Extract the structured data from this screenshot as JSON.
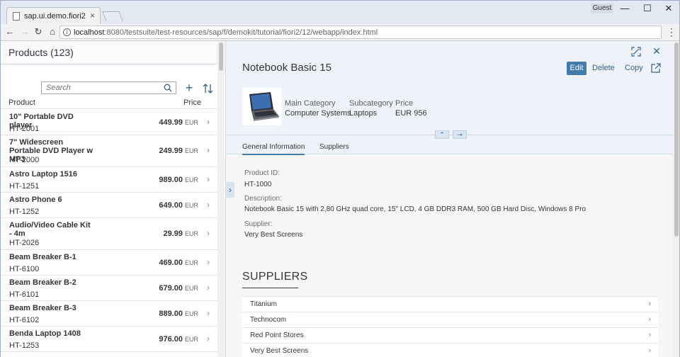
{
  "browser": {
    "tab_title": "sap.ui.demo.fiori2",
    "tab_close": "×",
    "user_label": "Guest",
    "url_host": "localhost",
    "url_path": ":8080/testsuite/test-resources/sap/f/demokit/tutorial/fiori2/12/webapp/index.html",
    "nav": {
      "back": "←",
      "forward": "→",
      "reload": "↻",
      "home": "⌂",
      "menu": "⋮"
    },
    "window_controls": {
      "minimize": "—",
      "maximize": "☐",
      "close": "✕"
    }
  },
  "master": {
    "title": "Products (123)",
    "search_placeholder": "Search",
    "add_label": "+",
    "columns": {
      "product": "Product",
      "price": "Price"
    },
    "currency": "EUR",
    "chevron": "›",
    "products": [
      {
        "name": "10\" Portable DVD player",
        "id": "HT-2001",
        "price": "449.99"
      },
      {
        "name": "7\" Widescreen Portable DVD Player w MP3",
        "id": "HT-2000",
        "price": "249.99"
      },
      {
        "name": "Astro Laptop 1516",
        "id": "HT-1251",
        "price": "989.00"
      },
      {
        "name": "Astro Phone 6",
        "id": "HT-1252",
        "price": "649.00"
      },
      {
        "name": "Audio/Video Cable Kit - 4m",
        "id": "HT-2026",
        "price": "29.99"
      },
      {
        "name": "Beam Breaker B-1",
        "id": "HT-6100",
        "price": "469.00"
      },
      {
        "name": "Beam Breaker B-2",
        "id": "HT-6101",
        "price": "679.00"
      },
      {
        "name": "Beam Breaker B-3",
        "id": "HT-6102",
        "price": "889.00"
      },
      {
        "name": "Benda Laptop 1408",
        "id": "HT-1253",
        "price": "976.00"
      }
    ]
  },
  "detail": {
    "title": "Notebook Basic 15",
    "actions": {
      "edit": "Edit",
      "delete": "Delete",
      "copy": "Copy"
    },
    "close_glyph": "✕",
    "attributes": {
      "main_category_label": "Main Category",
      "main_category_value": "Computer Systems",
      "subcategory_label": "Subcategory",
      "subcategory_value": "Laptops",
      "price_label": "Price",
      "price_value": "EUR 956"
    },
    "collapse_glyph": "⌃",
    "pin_glyph": "⊸",
    "tabs": [
      "General Information",
      "Suppliers"
    ],
    "expand_master_glyph": "›",
    "general": {
      "product_id_label": "Product ID:",
      "product_id_value": "HT-1000",
      "description_label": "Description:",
      "description_value": "Notebook Basic 15 with 2,80 GHz quad core, 15\" LCD, 4 GB DDR3 RAM, 500 GB Hard Disc, Windows 8 Pro",
      "supplier_label": "Supplier:",
      "supplier_value": "Very Best Screens"
    },
    "suppliers_title": "SUPPLIERS",
    "suppliers": [
      "Titanium",
      "Technocom",
      "Red Point Stores",
      "Very Best Screens"
    ],
    "chevron": "›"
  }
}
